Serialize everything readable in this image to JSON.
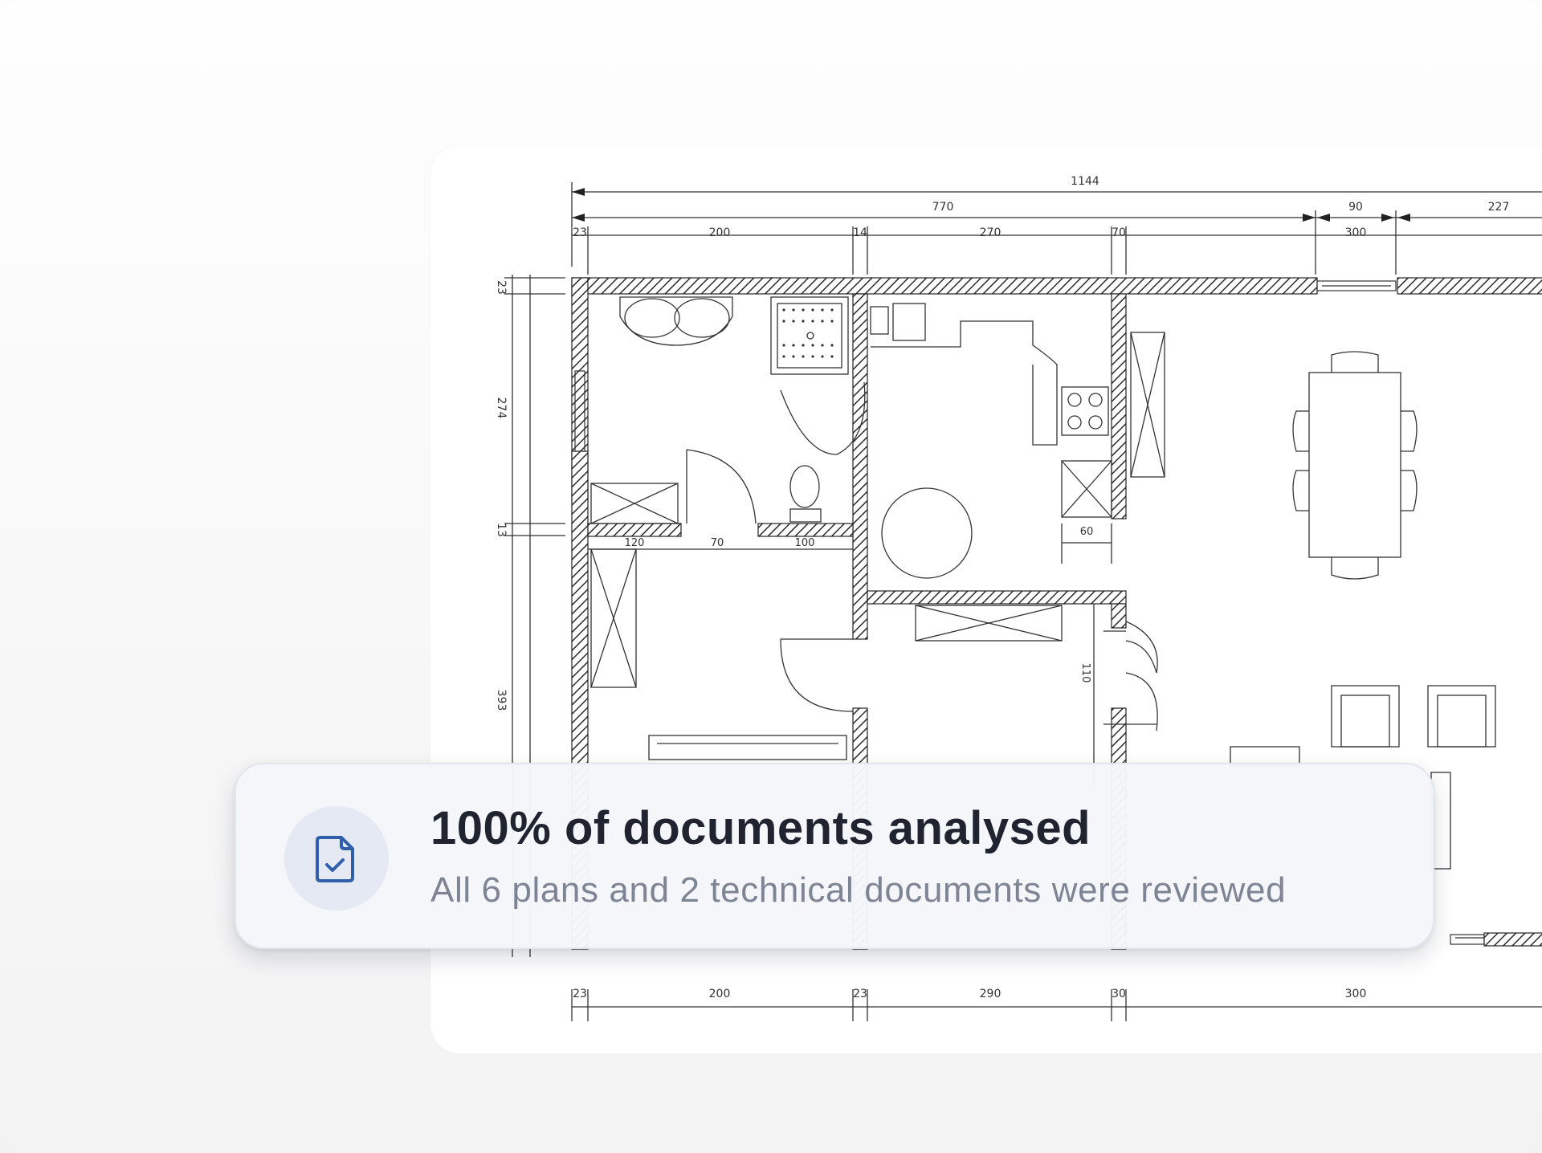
{
  "plan": {
    "dims_top": {
      "overall": "1144",
      "span_a": "770",
      "span_b": "90",
      "span_c": "227",
      "seg_1": "23",
      "seg_2": "200",
      "seg_3": "14",
      "seg_4": "270",
      "seg_5": "70",
      "seg_6": "300"
    },
    "dims_left": {
      "v1": "23",
      "v2": "274",
      "v3": "13",
      "v4": "393"
    },
    "dims_inner": {
      "d1": "120",
      "d2": "70",
      "d3": "100",
      "d4": "60",
      "d5": "110"
    },
    "dims_bottom": {
      "b1": "23",
      "b2": "200",
      "b3": "23",
      "b4": "290",
      "b5": "30",
      "b6": "300"
    }
  },
  "notification": {
    "icon": "document-check-icon",
    "title": "100% of documents analysed",
    "subtitle": "All 6 plans and 2 technical documents were reviewed",
    "accent_color": "#2f5fa8"
  }
}
